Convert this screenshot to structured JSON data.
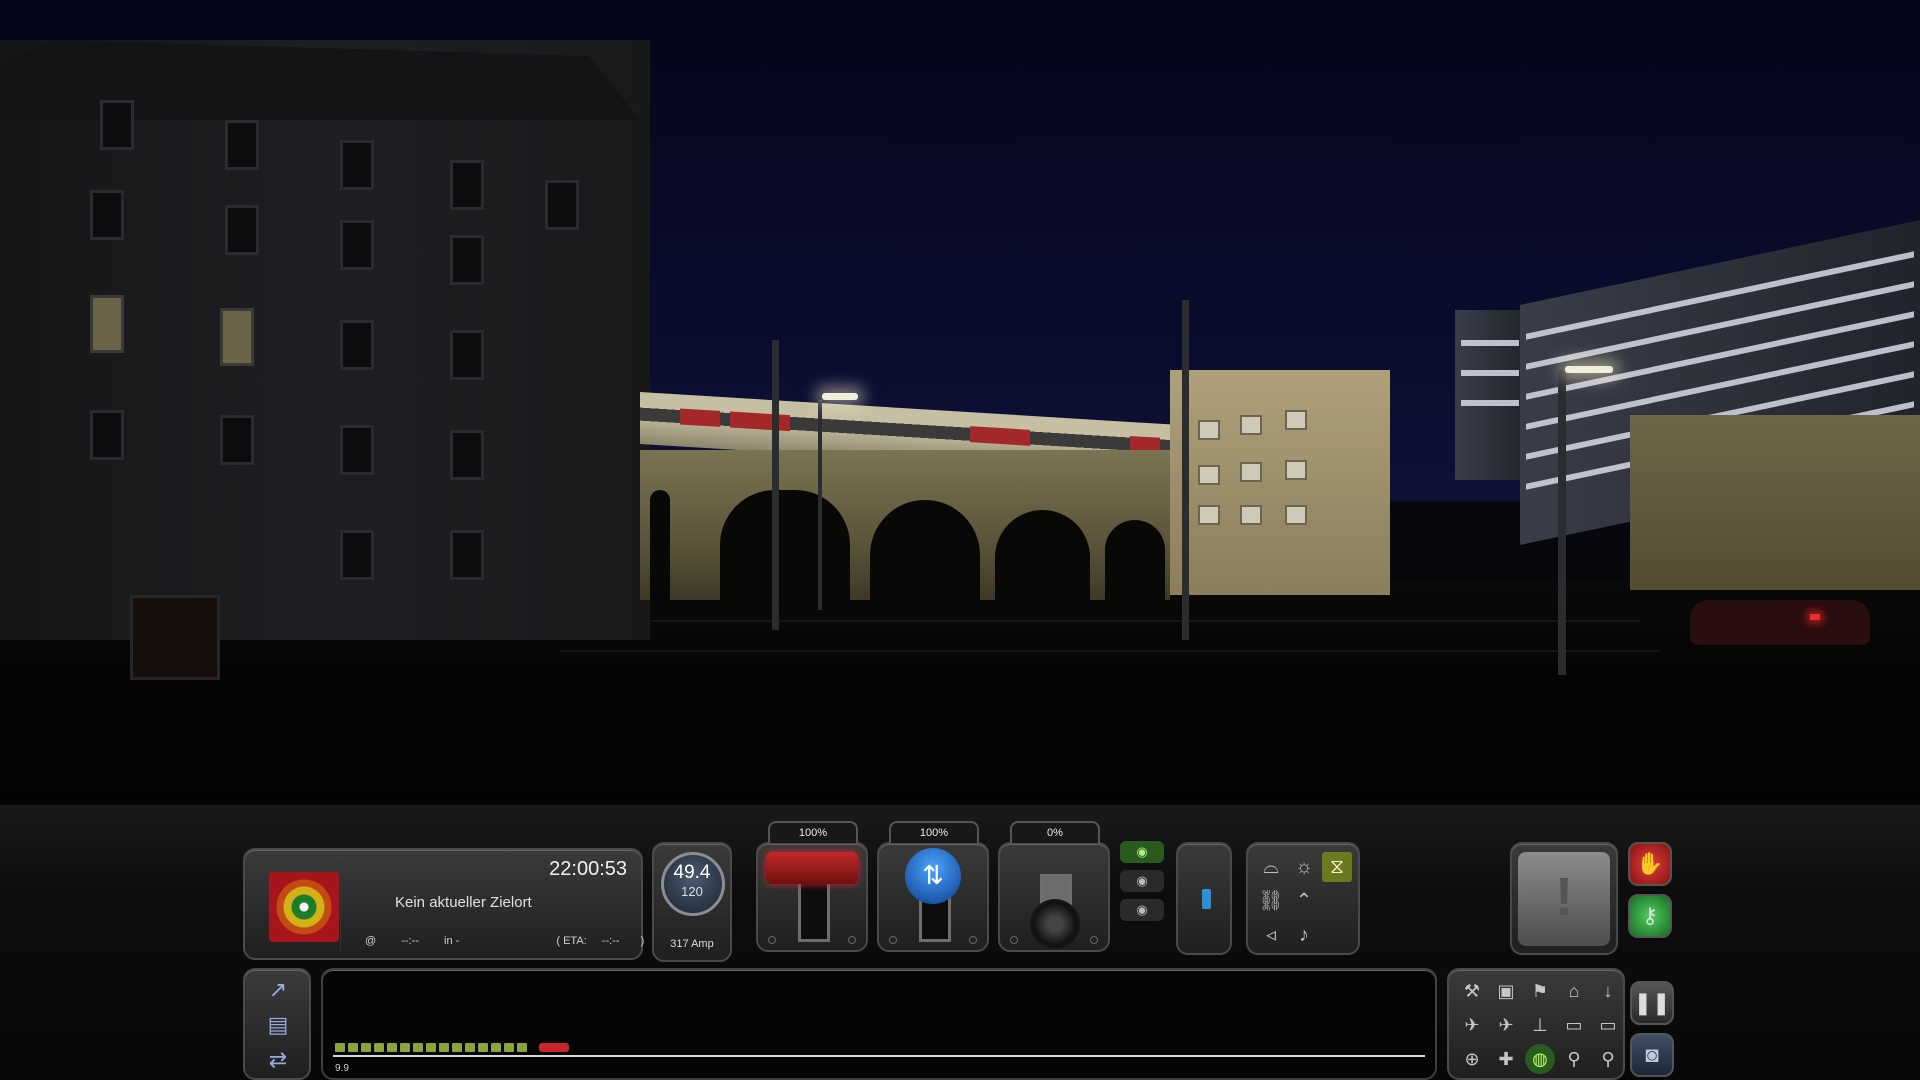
{
  "hud": {
    "info": {
      "time": "22:00:53",
      "destination": "Kein aktueller Zielort",
      "at_symbol": "@",
      "dep_time": "--:--",
      "in_label": "in -",
      "eta_label": "( ETA:",
      "eta_value": "--:--",
      "eta_close": ")"
    },
    "speedometer": {
      "speed": "49.4",
      "limit": "120",
      "current": "317 Amp"
    },
    "throttle": {
      "percent": "100%"
    },
    "reverser": {
      "percent": "100%"
    },
    "brake": {
      "percent": "0%"
    },
    "track_monitor": {
      "distance": "9.9"
    },
    "colors": {
      "accent_green": "#8da33b",
      "throttle_red": "#c22a2a",
      "reverser_blue": "#2d7fe0",
      "emergency_red": "#c22a2a",
      "go_green": "#2d9a3b"
    },
    "icons": [
      "camera-cab-icon",
      "camera-external-icon",
      "camera-passenger-icon",
      "wiper-icon",
      "headlight-icon",
      "sander-icon",
      "coupler-icon",
      "pantograph-icon",
      "horn-icon",
      "bell-icon",
      "pause-icon",
      "screenshot-icon",
      "emergency-brake-icon",
      "key-icon"
    ]
  }
}
